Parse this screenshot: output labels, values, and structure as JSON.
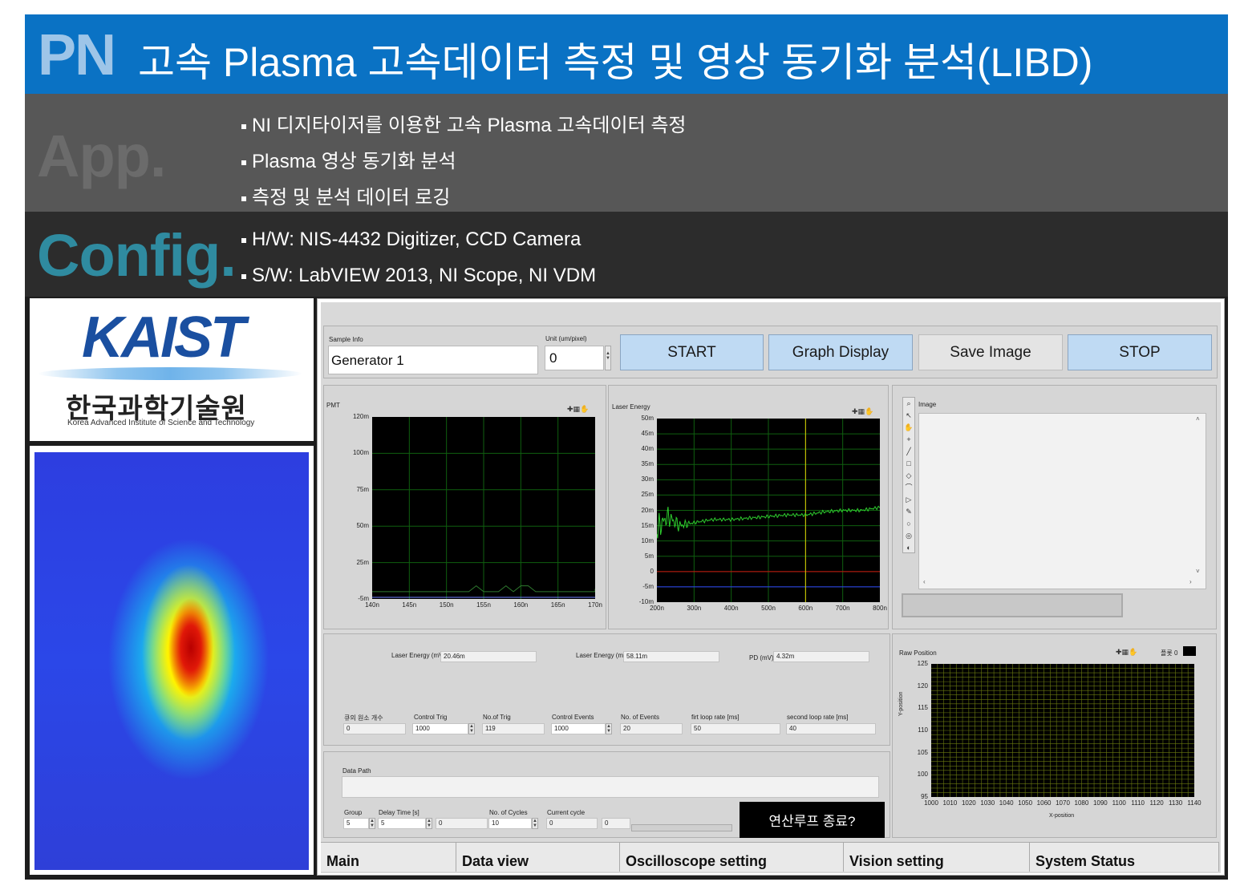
{
  "header": {
    "pn": "PN",
    "title": "고속 Plasma 고속데이터 측정 및 영상 동기화 분석(LIBD)"
  },
  "app": {
    "label": "App.",
    "bullets": [
      "NI 디지타이저를 이용한 고속 Plasma 고속데이터 측정",
      "Plasma 영상 동기화 분석",
      "측정 및 분석 데이터 로깅"
    ]
  },
  "config": {
    "label": "Config.",
    "bullets": [
      "H/W: NIS-4432 Digitizer, CCD Camera",
      "S/W: LabVIEW 2013,  NI Scope,  NI VDM"
    ]
  },
  "logo": {
    "name": "KAIST",
    "korean": "한국과학기술원",
    "english": "Korea Advanced Institute of Science and Technology"
  },
  "lv": {
    "sample_info_label": "Sample Info",
    "sample_info_value": "Generator 1",
    "unit_label": "Unit (um/pixel)",
    "unit_value": "0",
    "buttons": {
      "start": "START",
      "graph": "Graph Display",
      "save": "Save Image",
      "stop": "STOP"
    },
    "pmt": {
      "label": "PMT",
      "yticks": [
        "120m",
        "100m",
        "75m",
        "50m",
        "25m",
        "-5m"
      ],
      "xticks": [
        "140n",
        "145n",
        "150n",
        "155n",
        "160n",
        "165n",
        "170n"
      ]
    },
    "laser": {
      "label": "Laser Energy",
      "yticks": [
        "50m",
        "45m",
        "40m",
        "35m",
        "30m",
        "25m",
        "20m",
        "15m",
        "10m",
        "5m",
        "0",
        "-5m",
        "-10m"
      ],
      "xticks": [
        "200n",
        "300n",
        "400n",
        "500n",
        "600n",
        "700n",
        "800n"
      ]
    },
    "image_label": "Image",
    "readouts": [
      {
        "label": "Laser Energy (mV)",
        "value": "20.46m"
      },
      {
        "label": "Laser Energy (mJ)",
        "value": "58.11m"
      },
      {
        "label": "PD (mV)",
        "value": "4.32m"
      }
    ],
    "params": [
      {
        "label": "큐의 원소 개수",
        "value": "0"
      },
      {
        "label": "Control Trig",
        "value": "1000"
      },
      {
        "label": "No.of Trig",
        "value": "119"
      },
      {
        "label": "Control Events",
        "value": "1000"
      },
      {
        "label": "No. of Events",
        "value": "20"
      },
      {
        "label": "firt loop rate [ms]",
        "value": "50"
      },
      {
        "label": "second loop rate [ms]",
        "value": "40"
      }
    ],
    "data_path_label": "Data Path",
    "data_path_value": "",
    "cycle": {
      "group_label": "Group",
      "group_value": "5",
      "delay_label": "Delay Time [s]",
      "delay_value": "5",
      "delay_value2": "0",
      "cycles_label": "No. of Cycles",
      "cycles_value": "10",
      "current_label": "Current cycle",
      "current_value": "0",
      "current_value2": "0"
    },
    "end_loop": "연산루프 종료?",
    "raw": {
      "label": "Raw Position",
      "ylabel": "Y-position",
      "xlabel": "X-position",
      "plot_label": "플롯 0",
      "yticks": [
        "125",
        "120",
        "115",
        "110",
        "105",
        "100",
        "95"
      ],
      "xticks": [
        "1000",
        "1010",
        "1020",
        "1030",
        "1040",
        "1050",
        "1060",
        "1070",
        "1080",
        "1090",
        "1100",
        "1110",
        "1120",
        "1130",
        "1140"
      ]
    },
    "tabs": [
      "Main",
      "Data view",
      "Oscilloscope setting",
      "Vision setting",
      "System Status"
    ]
  },
  "colors": {
    "title_band": "#0a72c4",
    "app_band": "#575757",
    "config_band": "#2c2c2c",
    "button_blue": "#bfdaf3",
    "pmt_trace": "#2f7a2f",
    "laser_trace": "#2ecc2e",
    "grid": "#0f5f0f",
    "raw_grid": "#6b7a10"
  },
  "chart_data": [
    {
      "type": "line",
      "title": "PMT",
      "x_range": [
        "140n",
        "170n"
      ],
      "y_range": [
        "-5m",
        "120m"
      ],
      "series": [
        {
          "values": [
            [
              140,
              0
            ],
            [
              153,
              0
            ],
            [
              154,
              4
            ],
            [
              155,
              0
            ],
            [
              157,
              0
            ],
            [
              158,
              4
            ],
            [
              159,
              0
            ],
            [
              160,
              4
            ],
            [
              161,
              4
            ],
            [
              162,
              0
            ],
            [
              170,
              0
            ],
            [
              170,
              2
            ]
          ]
        }
      ]
    },
    {
      "type": "line",
      "title": "Laser Energy",
      "x_range": [
        "200n",
        "800n"
      ],
      "y_range": [
        "-10m",
        "50m"
      ],
      "series": [
        {
          "values": [
            [
              200,
              14
            ],
            [
              230,
              18
            ],
            [
              260,
              15
            ],
            [
              300,
              16
            ],
            [
              350,
              17
            ],
            [
              400,
              17
            ],
            [
              450,
              17.5
            ],
            [
              500,
              18
            ],
            [
              550,
              18.5
            ],
            [
              600,
              18.5
            ],
            [
              650,
              19.5
            ],
            [
              700,
              20
            ],
            [
              750,
              20
            ],
            [
              800,
              21
            ]
          ]
        }
      ]
    }
  ]
}
